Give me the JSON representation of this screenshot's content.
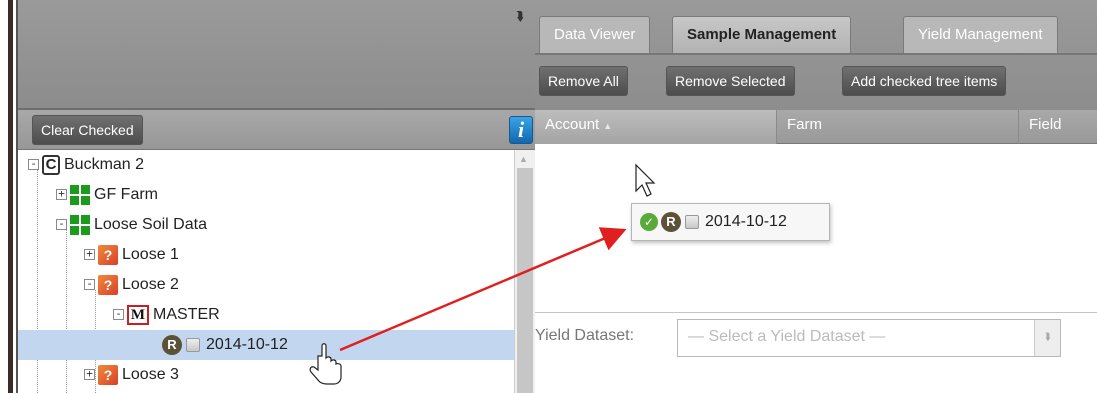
{
  "left_panel": {
    "collapse_icon": "double-chevron-down-icon",
    "clear_checked_label": "Clear Checked",
    "info_label": "i",
    "tree": [
      {
        "label": "Buckman 2",
        "icon": "C",
        "expander": "-"
      },
      {
        "label": "GF Farm",
        "icon": "farm-icon",
        "expander": "+"
      },
      {
        "label": "Loose Soil Data",
        "icon": "farm-icon",
        "expander": "-"
      },
      {
        "label": "Loose 1",
        "icon": "?",
        "expander": "+"
      },
      {
        "label": "Loose 2",
        "icon": "?",
        "expander": "-"
      },
      {
        "label": "MASTER",
        "icon": "M",
        "expander": "-"
      },
      {
        "label": "2014-10-12",
        "icon": "R",
        "expander": ""
      },
      {
        "label": "Loose 3",
        "icon": "?",
        "expander": "+"
      }
    ]
  },
  "right_panel": {
    "tabs": [
      "Data Viewer",
      "Sample Management",
      "Yield Management"
    ],
    "active_tab": "Sample Management",
    "toolbar": {
      "remove_all_label": "Remove All",
      "remove_selected_label": "Remove Selected",
      "add_checked_label": "Add checked tree items"
    },
    "columns": [
      "Account",
      "Farm",
      "Field"
    ],
    "drag_item": {
      "icon": "R",
      "label": "2014-10-12",
      "status_icon": "check-circle-icon"
    },
    "yield": {
      "label": "Yield Dataset:",
      "placeholder": "— Select a Yield Dataset —"
    }
  },
  "colors": {
    "selection": "#c2d7ef",
    "arrow": "#e02020",
    "farm_green": "#1b9a1b",
    "info_blue": "#1168b0"
  }
}
